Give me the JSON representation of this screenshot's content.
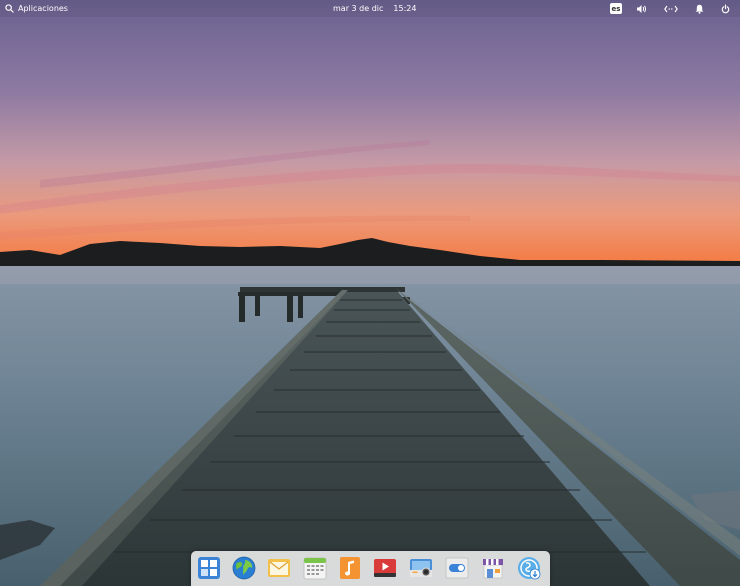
{
  "panel": {
    "applications_label": "Aplicaciones",
    "date": "mar  3 de dic",
    "time": "15:24",
    "keyboard_layout": "es",
    "indicators": [
      "keyboard-layout",
      "volume-icon",
      "network-icon",
      "notifications-icon",
      "power-icon"
    ]
  },
  "dock": {
    "apps": [
      {
        "name": "multitasking-view-icon"
      },
      {
        "name": "web-browser-icon"
      },
      {
        "name": "mail-icon"
      },
      {
        "name": "calendar-icon"
      },
      {
        "name": "music-icon"
      },
      {
        "name": "videos-icon"
      },
      {
        "name": "photos-icon"
      },
      {
        "name": "system-settings-icon"
      },
      {
        "name": "appcenter-icon"
      },
      {
        "name": "installer-icon"
      }
    ]
  },
  "colors": {
    "sky_top": "#6f6593",
    "sky_horizon": "#f08a52",
    "water": "#6e8495",
    "dock_bg": "#f2f2f2"
  }
}
